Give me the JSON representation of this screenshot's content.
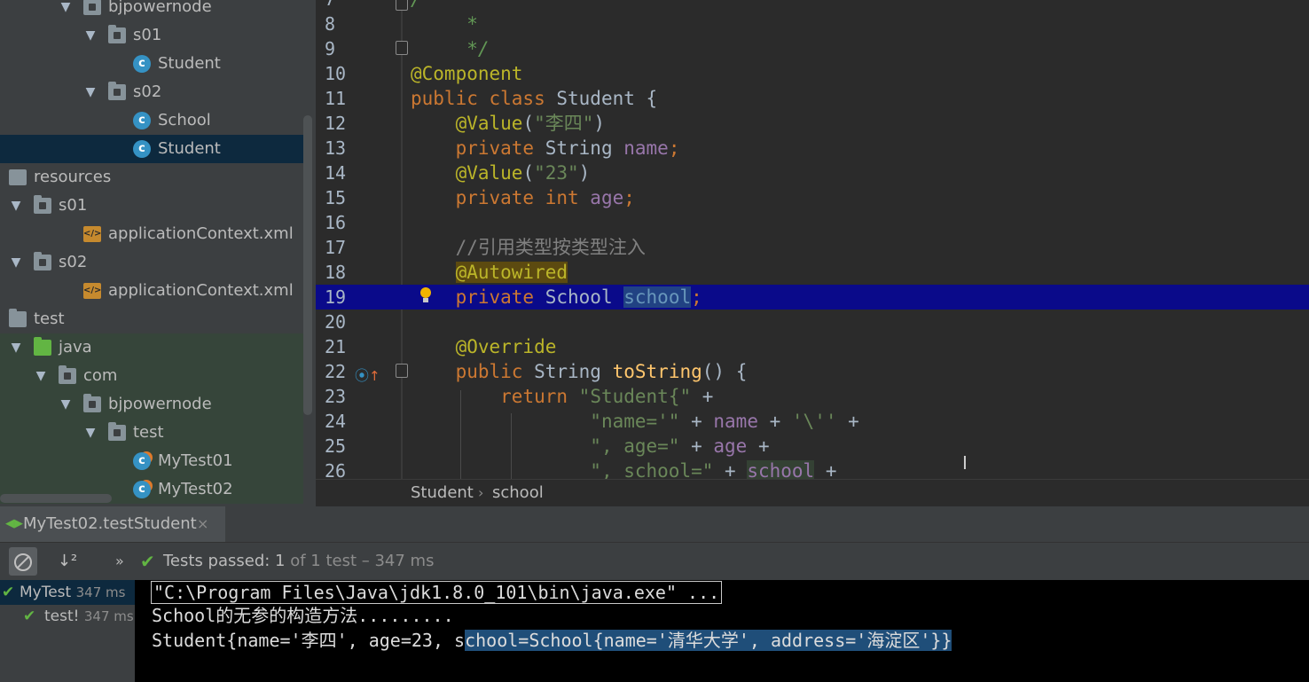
{
  "tree": {
    "items": [
      {
        "label": "bjpowernode",
        "type": "package",
        "indent": 2,
        "expanded": true
      },
      {
        "label": "s01",
        "type": "package",
        "indent": 3,
        "expanded": true
      },
      {
        "label": "Student",
        "type": "class",
        "indent": 4
      },
      {
        "label": "s02",
        "type": "package",
        "indent": 3,
        "expanded": true
      },
      {
        "label": "School",
        "type": "class",
        "indent": 4
      },
      {
        "label": "Student",
        "type": "class",
        "indent": 4,
        "selected": true
      },
      {
        "label": "resources",
        "type": "resources",
        "indent": 0
      },
      {
        "label": "s01",
        "type": "package",
        "indent": 0,
        "expanded": true
      },
      {
        "label": "applicationContext.xml",
        "type": "xml",
        "indent": 2
      },
      {
        "label": "s02",
        "type": "package",
        "indent": 0,
        "expanded": true
      },
      {
        "label": "applicationContext.xml",
        "type": "xml",
        "indent": 2
      },
      {
        "label": "test",
        "type": "folder",
        "indent": -1
      },
      {
        "label": "java",
        "type": "test-root",
        "indent": 0,
        "expanded": true
      },
      {
        "label": "com",
        "type": "package",
        "indent": 1,
        "expanded": true
      },
      {
        "label": "bjpowernode",
        "type": "package",
        "indent": 2,
        "expanded": true
      },
      {
        "label": "test",
        "type": "package",
        "indent": 3,
        "expanded": true
      },
      {
        "label": "MyTest01",
        "type": "test-class",
        "indent": 4
      },
      {
        "label": "MyTest02",
        "type": "test-class",
        "indent": 4
      }
    ]
  },
  "editor": {
    "lines": [
      {
        "n": "7",
        "segs": [
          [
            "cmtd",
            "/"
          ]
        ]
      },
      {
        "n": "8",
        "segs": [
          [
            "cmtd",
            "     *"
          ]
        ]
      },
      {
        "n": "9",
        "segs": [
          [
            "cmtd",
            "     */"
          ]
        ]
      },
      {
        "n": "10",
        "segs": [
          [
            "ann",
            "@Component"
          ]
        ]
      },
      {
        "n": "11",
        "segs": [
          [
            "kw",
            "public class "
          ],
          [
            "",
            "Student {"
          ]
        ]
      },
      {
        "n": "12",
        "segs": [
          [
            "",
            "    "
          ],
          [
            "ann",
            "@Value"
          ],
          [
            "",
            "("
          ],
          [
            "str",
            "\"李四\""
          ],
          [
            "",
            ")"
          ]
        ]
      },
      {
        "n": "13",
        "segs": [
          [
            "",
            "    "
          ],
          [
            "kw",
            "private "
          ],
          [
            "",
            "String "
          ],
          [
            "fld",
            "name"
          ],
          [
            "kw",
            ";"
          ]
        ]
      },
      {
        "n": "14",
        "segs": [
          [
            "",
            "    "
          ],
          [
            "ann",
            "@Value"
          ],
          [
            "",
            "("
          ],
          [
            "str",
            "\"23\""
          ],
          [
            "",
            ")"
          ]
        ]
      },
      {
        "n": "15",
        "segs": [
          [
            "",
            "    "
          ],
          [
            "kw",
            "private int "
          ],
          [
            "fld",
            "age"
          ],
          [
            "kw",
            ";"
          ]
        ]
      },
      {
        "n": "16",
        "segs": []
      },
      {
        "n": "17",
        "segs": [
          [
            "",
            "    "
          ],
          [
            "cmt",
            "//引用类型按类型注入"
          ]
        ]
      },
      {
        "n": "18",
        "segs": [
          [
            "",
            "    "
          ],
          [
            "hl-ann",
            "@Autowired"
          ]
        ]
      },
      {
        "n": "19",
        "segs": [
          [
            "",
            "    "
          ],
          [
            "kw",
            "private "
          ],
          [
            "",
            "School "
          ],
          [
            "hl-sel",
            "school"
          ],
          [
            "kw",
            ";"
          ]
        ],
        "current": true
      },
      {
        "n": "20",
        "segs": []
      },
      {
        "n": "21",
        "segs": [
          [
            "",
            "    "
          ],
          [
            "ann",
            "@Override"
          ]
        ]
      },
      {
        "n": "22",
        "segs": [
          [
            "",
            "    "
          ],
          [
            "kw",
            "public "
          ],
          [
            "",
            "String "
          ],
          [
            "fn",
            "toString"
          ],
          [
            "",
            "() {"
          ]
        ]
      },
      {
        "n": "23",
        "segs": [
          [
            "",
            "        "
          ],
          [
            "kw",
            "return "
          ],
          [
            "str",
            "\"Student{\""
          ],
          [
            "",
            " +"
          ]
        ]
      },
      {
        "n": "24",
        "segs": [
          [
            "",
            "                "
          ],
          [
            "str",
            "\"name='\""
          ],
          [
            "",
            " + "
          ],
          [
            "fld",
            "name"
          ],
          [
            "",
            " + "
          ],
          [
            "str",
            "'\\''"
          ],
          [
            "",
            " +"
          ]
        ]
      },
      {
        "n": "25",
        "segs": [
          [
            "",
            "                "
          ],
          [
            "str",
            "\", age=\""
          ],
          [
            "",
            " + "
          ],
          [
            "fld",
            "age"
          ],
          [
            "",
            " +"
          ]
        ]
      },
      {
        "n": "26",
        "segs": [
          [
            "",
            "                "
          ],
          [
            "str",
            "\", school=\""
          ],
          [
            "",
            " + "
          ],
          [
            "hl-fld",
            "school"
          ],
          [
            "",
            " +"
          ]
        ]
      }
    ]
  },
  "breadcrumb": {
    "class_name": "Student",
    "separator": "›",
    "field_name": "school"
  },
  "run": {
    "tab_label": "MyTest02.testStudent",
    "close_glyph": "×",
    "more_glyph": "»",
    "status_main": "Tests passed: ",
    "status_count": "1",
    "status_of": " of 1 test – 347 ms",
    "tests": [
      {
        "name": "MyTest",
        "time": "347 ms",
        "selected": true
      },
      {
        "name": "test!",
        "time": "347 ms",
        "selected": false
      }
    ],
    "console": {
      "cmd": "\"C:\\Program Files\\Java\\jdk1.8.0_101\\bin\\java.exe\" ...",
      "line2": "School的无参的构造方法.........",
      "line3_a": "Student{name='李四', age=23, s",
      "line3_b": "chool=School{name='清华大学', address='海淀区'}}"
    }
  },
  "colors": {
    "editor_bg": "#2b2b2b",
    "keyword": "#cc7832",
    "annotation": "#bbb529",
    "string": "#6a8759",
    "field": "#9876aa",
    "current_line": "#0a0a8a",
    "test_pass": "#62b543"
  },
  "icons": [
    "folder-icon",
    "class-icon",
    "xml-file-icon",
    "lightbulb-icon",
    "override-gutter-icon",
    "stop-icon",
    "sort-icon",
    "check-icon",
    "run-tab-icon"
  ]
}
